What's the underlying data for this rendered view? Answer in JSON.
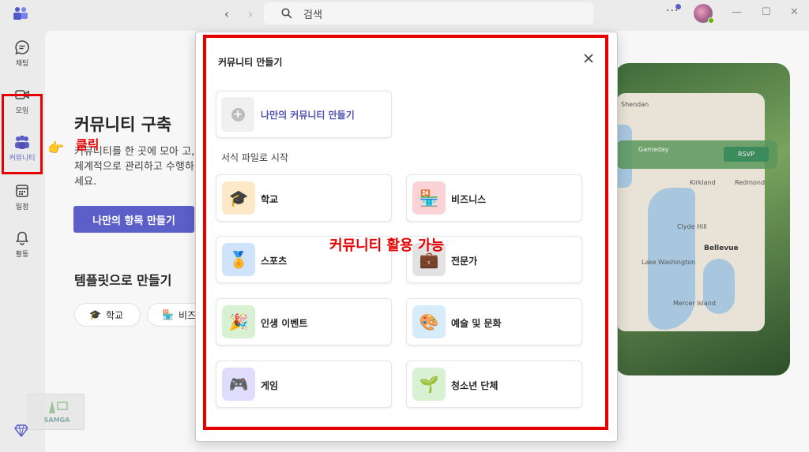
{
  "topbar": {
    "search_placeholder": "검색",
    "back_icon": "chevron-left-icon",
    "forward_icon": "chevron-right-icon",
    "more_icon": "more-horizontal-icon"
  },
  "rail": {
    "items": [
      {
        "label": "채팅",
        "icon": "chat-icon"
      },
      {
        "label": "모임",
        "icon": "video-icon"
      },
      {
        "label": "커뮤니티",
        "icon": "people-community-icon"
      },
      {
        "label": "일정",
        "icon": "calendar-icon"
      },
      {
        "label": "활동",
        "icon": "bell-icon"
      }
    ],
    "premium_icon": "diamond-icon"
  },
  "background": {
    "title": "커뮤니티 구축",
    "description": "커뮤니티를 한 곳에 모아 고, 체계적으로 관리하고 수행하세요.",
    "create_button": "나만의 항목 만들기",
    "template_title": "템플릿으로 만들기",
    "chips": [
      {
        "label": "학교",
        "icon": "graduation-cap-icon"
      },
      {
        "label": "비즈",
        "icon": "store-icon"
      }
    ],
    "click_annotation": "클릭",
    "map": {
      "banner_title": "Gameday",
      "rsvp": "RSVP",
      "places": [
        "Shendan",
        "Kirkland",
        "Redmond",
        "Clyde Hill",
        "Bellevue",
        "Lake Washington",
        "Mercer Island"
      ]
    },
    "watermark": "SAMGA"
  },
  "modal": {
    "title": "커뮤니티 만들기",
    "own_label": "나만의 커뮤니티 만들기",
    "section_label": "서식 파일로 시작",
    "annotation": "커뮤니티 활용 가능",
    "templates": [
      {
        "label": "학교",
        "icon": "graduation-cap-icon",
        "color": "#fde9c7"
      },
      {
        "label": "비즈니스",
        "icon": "storefront-icon",
        "color": "#fbd3d6"
      },
      {
        "label": "스포츠",
        "icon": "medal-icon",
        "color": "#cfe3fb"
      },
      {
        "label": "전문가",
        "icon": "briefcase-icon",
        "color": "#e2e2e2"
      },
      {
        "label": "인생 이벤트",
        "icon": "party-popper-icon",
        "color": "#d9f1d3"
      },
      {
        "label": "예술 및 문화",
        "icon": "palette-icon",
        "color": "#d6ecfa"
      },
      {
        "label": "게임",
        "icon": "game-controller-icon",
        "color": "#e0dcfb"
      },
      {
        "label": "청소년 단체",
        "icon": "seedling-icon",
        "color": "#d9f1d3"
      }
    ]
  },
  "colors": {
    "accent": "#5b5fc7",
    "highlight_red": "#e60000"
  }
}
